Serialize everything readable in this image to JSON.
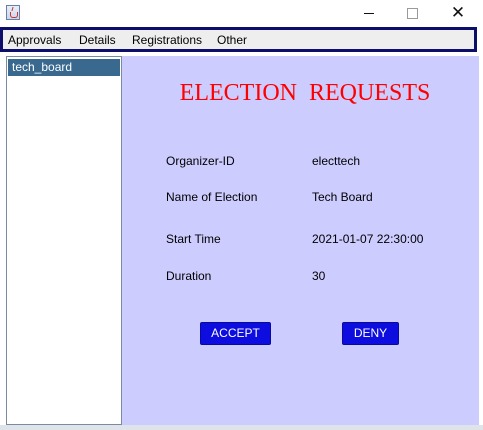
{
  "window": {
    "close_glyph": "✕"
  },
  "menu": {
    "items": [
      "Approvals",
      "Details",
      "Registrations",
      "Other"
    ]
  },
  "sidebar": {
    "items": [
      "tech_board"
    ]
  },
  "main": {
    "title": "ELECTION  REQUESTS",
    "fields": [
      {
        "label": "Organizer-ID",
        "value": "electtech"
      },
      {
        "label": "Name of Election",
        "value": "Tech Board"
      },
      {
        "label": "Start Time",
        "value": "2021-01-07 22:30:00"
      },
      {
        "label": "Duration",
        "value": "30"
      }
    ],
    "accept_label": "ACCEPT",
    "deny_label": "DENY"
  },
  "colors": {
    "title": "#ff0000",
    "panel_background": "#ccccff",
    "button": "#0d0de0",
    "selected_item": "#39698f",
    "menubar_border": "#0d0d6b"
  },
  "icons": {
    "app": "java-cup-icon",
    "minimize": "minimize-icon",
    "maximize": "maximize-icon",
    "close": "close-icon"
  }
}
